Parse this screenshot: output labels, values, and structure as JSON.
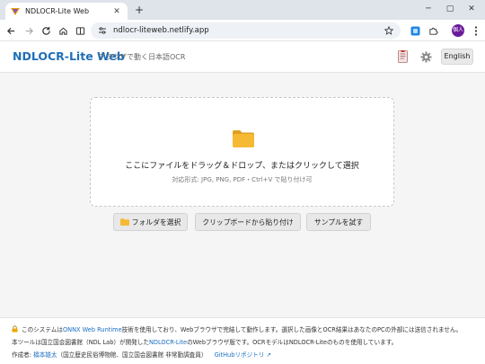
{
  "browser": {
    "tab_title": "NDLOCR-Lite Web",
    "tab_close": "✕",
    "new_tab": "+",
    "window_controls": [
      "─",
      "▢",
      "✕"
    ],
    "url": "ndlocr-liteweb.netlify.app",
    "avatar_text": "個人"
  },
  "app": {
    "brand": "NDLOCR-Lite Web",
    "tagline": "ブラウザで動く日本語OCR",
    "lang_button": "English"
  },
  "dropzone": {
    "title": "ここにファイルをドラッグ＆ドロップ、またはクリックして選択",
    "subtitle": "対応形式: JPG, PNG, PDF・Ctrl+V で貼り付け可"
  },
  "actions": {
    "select_folder": "フォルダを選択",
    "paste_clipboard": "クリップボードから貼り付け",
    "try_sample": "サンプルを試す"
  },
  "footer": {
    "line1_pre": "このシステムは",
    "line1_link": "ONNX Web Runtime",
    "line1_post": "技術を使用しており、Webブラウザで完結して動作します。選択した画像とOCR結果はあなたのPCの外部には送信されません。",
    "line2_pre": "本ツールは国立国会図書館（NDL Lab）が開発した",
    "line2_link": "NDLOCR-Lite",
    "line2_post": "のWebブラウザ版です。OCRモデルはNDLOCR-Liteのものを使用しています。",
    "line3_pre": "作成者:",
    "line3_author": "橋本雄太",
    "line3_affil": "（国立歴史民俗博物館、国立国会図書館 非常勤調査員）",
    "line3_github": "GitHubリポジトリ ↗"
  },
  "colors": {
    "brand": "#1f6fb8",
    "link": "#1a6fc4",
    "folder": "#f5b933"
  }
}
